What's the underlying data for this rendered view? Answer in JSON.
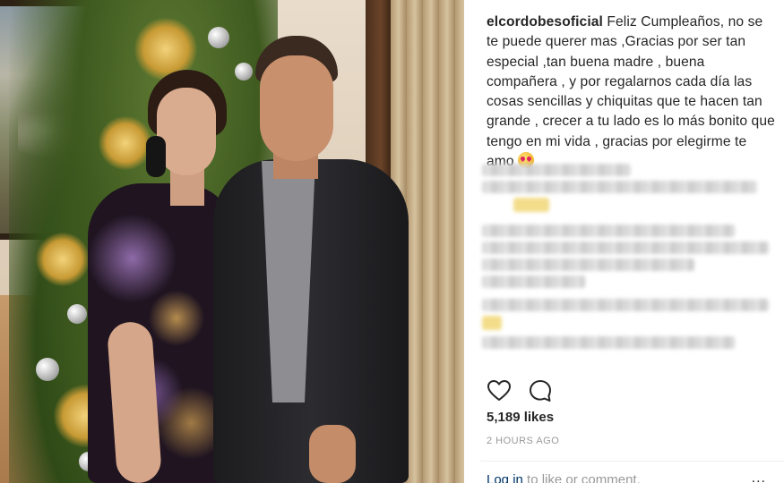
{
  "post": {
    "username": "elcordobesoficial",
    "caption": "Feliz Cumpleaños, no se te puede querer mas ,Gracias por ser tan especial ,tan buena madre , buena compañera , y por regalarnos cada día las cosas sencillas y chiquitas que te hacen tan grande , crecer a tu lado es lo más bonito que tengo en mi vida , gracias por elegirme te amo",
    "emoji_icon": "heart-eyes-emoji-icon"
  },
  "actions": {
    "like_icon": "heart-icon",
    "comment_icon": "comment-icon"
  },
  "stats": {
    "likes": "5,189 likes",
    "time": "2 HOURS AGO"
  },
  "footer": {
    "login_link": "Log in",
    "login_text": " to like or comment.",
    "more_icon": "more-options-icon",
    "more_label": "..."
  },
  "colors": {
    "text": "#262626",
    "muted": "#999999",
    "link": "#003569"
  }
}
